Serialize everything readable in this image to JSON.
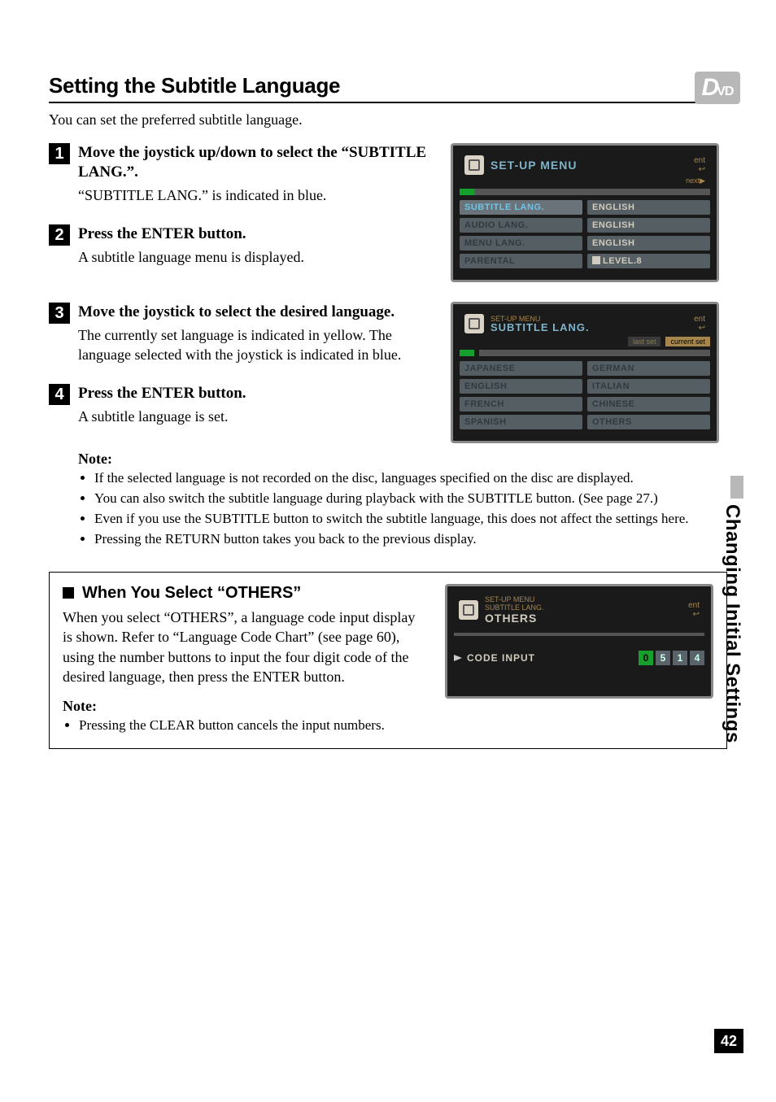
{
  "badge": {
    "d": "D",
    "vd": "VD"
  },
  "heading": "Setting the Subtitle Language",
  "intro": "You can set the preferred subtitle language.",
  "steps": [
    {
      "num": "1",
      "title": "Move the joystick up/down to select the “SUBTITLE LANG.”.",
      "text": "“SUBTITLE LANG.” is indicated in blue."
    },
    {
      "num": "2",
      "title": "Press the ENTER button.",
      "text": "A subtitle language menu is displayed."
    },
    {
      "num": "3",
      "title": "Move the joystick to select the desired language.",
      "text": "The currently set language is indicated in yellow. The language selected with the joystick is indicated in blue."
    },
    {
      "num": "4",
      "title": "Press the ENTER button.",
      "text": "A subtitle language is set."
    }
  ],
  "note_label": "Note:",
  "notes": [
    "If the selected language is not recorded on the disc, languages specified on the disc are displayed.",
    "You can also switch the subtitle language during playback with the SUBTITLE button. (See page 27.)",
    "Even if you use the SUBTITLE button to switch the subtitle language, this does not affect the settings here.",
    "Pressing the RETURN button takes you back to the previous display."
  ],
  "panel": {
    "heading": "When You Select “OTHERS”",
    "text": "When you select “OTHERS”, a language code input display is shown. Refer to “Language Code Chart” (see page 60), using the number buttons to input the four digit code of the desired language, then press the ENTER button.",
    "note_label": "Note:",
    "note": "Pressing the CLEAR button cancels the input numbers."
  },
  "side_label": "Changing Initial Settings",
  "page_number": "42",
  "screen1": {
    "title": "SET-UP MENU",
    "exit": "ent",
    "nav": "next▶",
    "rows": [
      {
        "label": "SUBTITLE LANG.",
        "value": "ENGLISH"
      },
      {
        "label": "AUDIO LANG.",
        "value": "ENGLISH"
      },
      {
        "label": "MENU LANG.",
        "value": "ENGLISH"
      },
      {
        "label": "PARENTAL",
        "value": "LEVEL.8",
        "lock": true
      }
    ]
  },
  "screen2": {
    "super": "SET-UP MENU",
    "title": "SUBTITLE LANG.",
    "exit": "ent",
    "tabs": [
      "last set",
      "current set"
    ],
    "cols": [
      [
        "JAPANESE",
        "ENGLISH",
        "FRENCH",
        "SPANISH"
      ],
      [
        "GERMAN",
        "ITALIAN",
        "CHINESE",
        "OTHERS"
      ]
    ]
  },
  "screen3": {
    "crumb1": "SET-UP MENU",
    "crumb2": "SUBTITLE LANG.",
    "title": "OTHERS",
    "exit": "ent",
    "label": "CODE INPUT",
    "digits": [
      "0",
      "5",
      "1",
      "4"
    ]
  }
}
